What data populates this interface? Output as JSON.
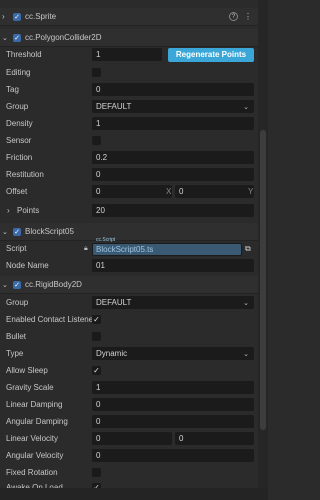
{
  "sprite": {
    "title": "cc.Sprite"
  },
  "polygon": {
    "title": "cc.PolygonCollider2D",
    "threshold_label": "Threshold",
    "threshold_value": "1",
    "regen_button": "Regenerate Points",
    "editing_label": "Editing",
    "tag_label": "Tag",
    "tag_value": "0",
    "group_label": "Group",
    "group_value": "DEFAULT",
    "density_label": "Density",
    "density_value": "1",
    "sensor_label": "Sensor",
    "friction_label": "Friction",
    "friction_value": "0.2",
    "restitution_label": "Restitution",
    "restitution_value": "0",
    "offset_label": "Offset",
    "offset_x": "0",
    "offset_y": "0",
    "x_axis": "X",
    "y_axis": "Y",
    "points_label": "Points",
    "points_value": "20"
  },
  "blockscript": {
    "title": "BlockScript05",
    "script_type_tag": "cc.Script",
    "script_label": "Script",
    "script_value": "BlockScript05.ts",
    "node_name_label": "Node Name",
    "node_name_value": "01"
  },
  "rigidbody": {
    "title": "cc.RigidBody2D",
    "group_label": "Group",
    "group_value": "DEFAULT",
    "contact_label": "Enabled Contact Listener",
    "bullet_label": "Bullet",
    "type_label": "Type",
    "type_value": "Dynamic",
    "sleep_label": "Allow Sleep",
    "gravity_label": "Gravity Scale",
    "gravity_value": "1",
    "lin_damp_label": "Linear Damping",
    "lin_damp_value": "0",
    "ang_damp_label": "Angular Damping",
    "ang_damp_value": "0",
    "lin_vel_label": "Linear Velocity",
    "lin_vel_x": "0",
    "lin_vel_y": "0",
    "ang_vel_label": "Angular Velocity",
    "ang_vel_value": "0",
    "fixed_rot_label": "Fixed Rotation",
    "awake_label": "Awake On Load"
  },
  "colors": {
    "accent": "#3aa7d8",
    "background": "#2b2b2b",
    "input": "#1b1b1b",
    "check": "#3b6aa8"
  }
}
